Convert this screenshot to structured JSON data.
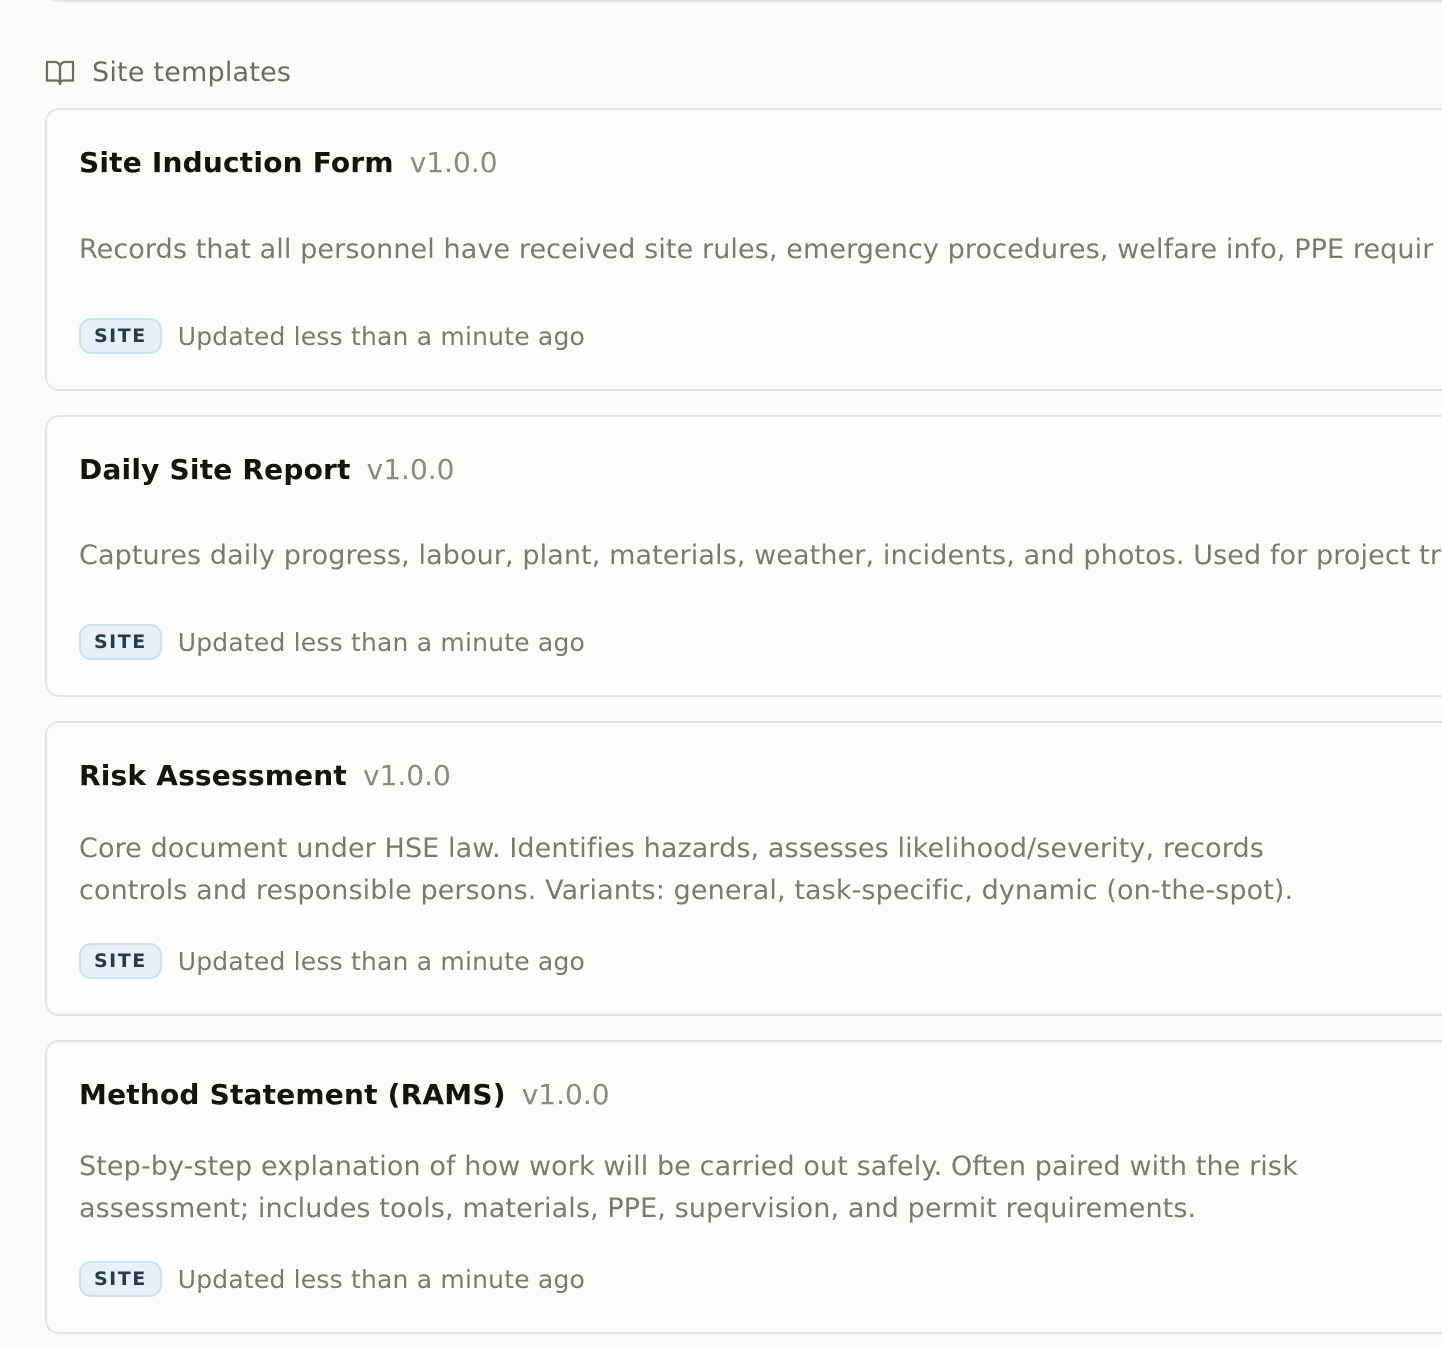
{
  "section": {
    "icon": "book-open-icon",
    "title": "Site templates"
  },
  "templates": [
    {
      "name": "Site Induction Form",
      "version": "v1.0.0",
      "description": "Records that all personnel have received site rules, emergency procedures, welfare info, PPE requir",
      "badge": "SITE",
      "updated": "Updated less than a minute ago"
    },
    {
      "name": "Daily Site Report",
      "version": "v1.0.0",
      "description": "Captures daily progress, labour, plant, materials, weather, incidents, and photos. Used for project tr",
      "badge": "SITE",
      "updated": "Updated less than a minute ago"
    },
    {
      "name": "Risk Assessment",
      "version": "v1.0.0",
      "description": "Core document under HSE law. Identifies hazards, assesses likelihood/severity, records controls and responsible persons. Variants: general, task-specific, dynamic (on-the-spot).",
      "badge": "SITE",
      "updated": "Updated less than a minute ago"
    },
    {
      "name": "Method Statement (RAMS)",
      "version": "v1.0.0",
      "description": "Step-by-step explanation of how work will be carried out safely. Often paired with the risk assessment; includes tools, materials, PPE, supervision, and permit requirements.",
      "badge": "SITE",
      "updated": "Updated less than a minute ago"
    }
  ],
  "colors": {
    "badge_bg": "#e8f1f8",
    "badge_border": "#cfe0ee",
    "title": "#14140f",
    "muted": "#7a7a72"
  }
}
